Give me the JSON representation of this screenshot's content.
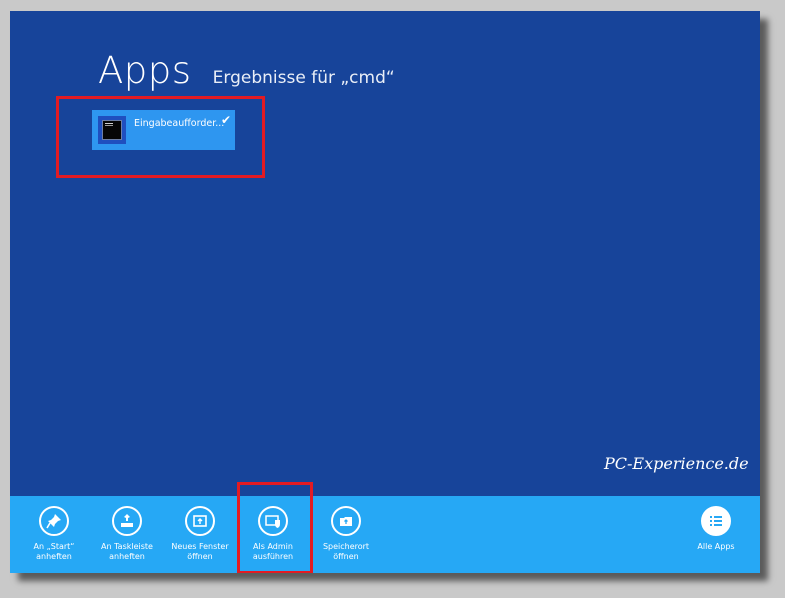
{
  "screen": {
    "title": "Apps",
    "subtitle": "Ergebnisse für „cmd“"
  },
  "results": [
    {
      "name": "Eingabeaufforder...",
      "selected": true,
      "icon": "command-prompt-icon"
    }
  ],
  "watermark": "PC-Experience.de",
  "appbar": {
    "commands": [
      {
        "line1": "An „Start“",
        "line2": "anheften",
        "icon": "pin-icon"
      },
      {
        "line1": "An Taskleiste",
        "line2": "anheften",
        "icon": "taskbar-pin-icon"
      },
      {
        "line1": "Neues Fenster",
        "line2": "öffnen",
        "icon": "new-window-icon"
      },
      {
        "line1": "Als Admin",
        "line2": "ausführen",
        "icon": "admin-shield-icon"
      },
      {
        "line1": "Speicherort",
        "line2": "öffnen",
        "icon": "folder-open-icon"
      }
    ],
    "right_command": {
      "line1": "Alle Apps",
      "icon": "all-apps-icon"
    }
  },
  "colors": {
    "background": "#17449a",
    "appbar": "#26a8f5",
    "tile": "#2e96f0",
    "highlight": "#e21b23"
  }
}
